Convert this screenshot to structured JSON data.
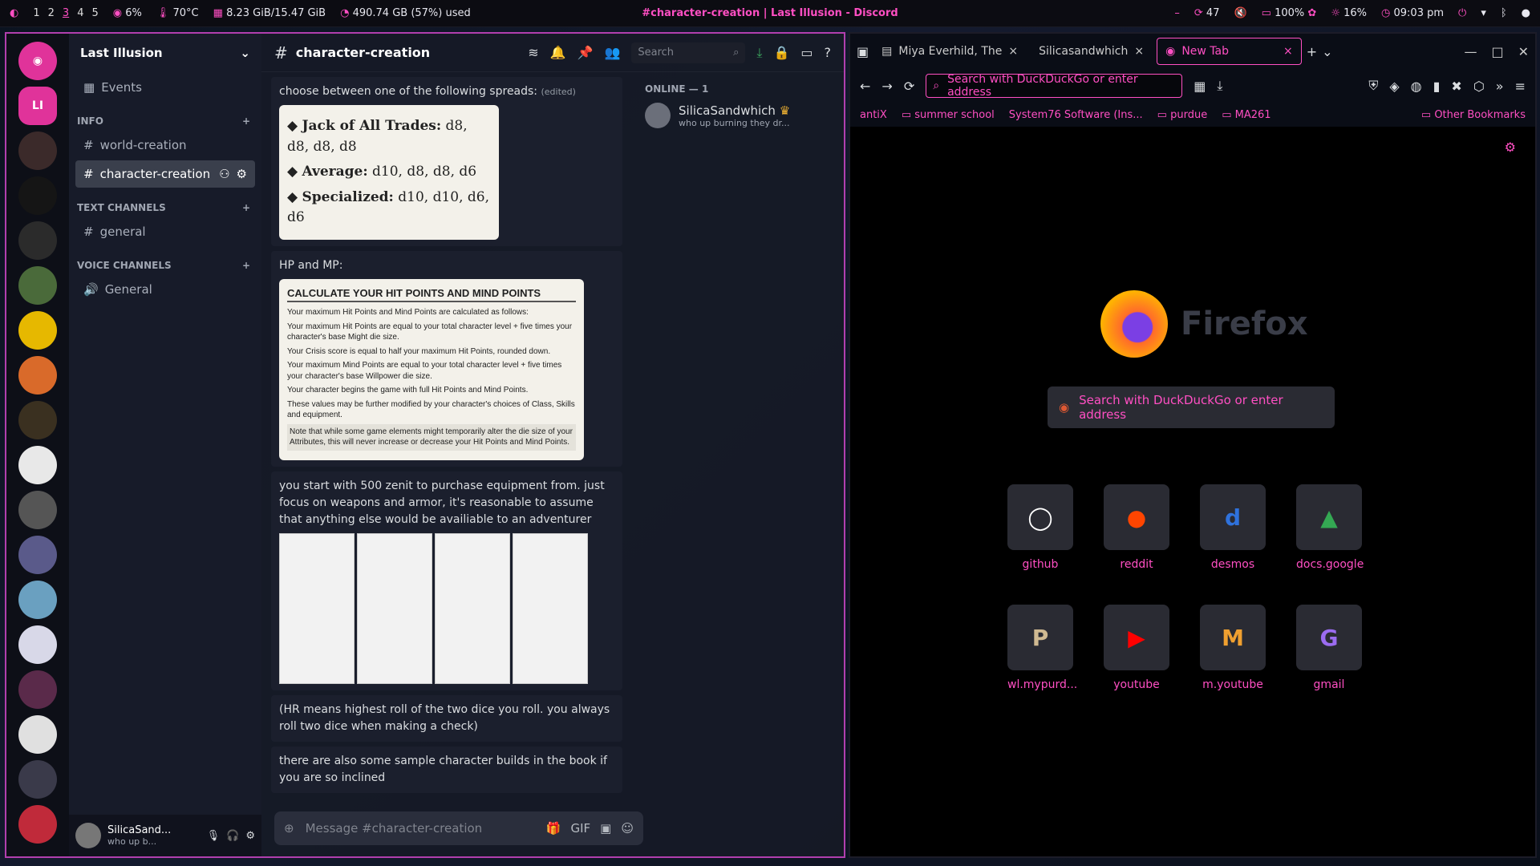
{
  "topbar": {
    "workspaces": [
      "1",
      "2",
      "3",
      "4",
      "5"
    ],
    "active_workspace": "3",
    "cpu": "6%",
    "temp": "70°C",
    "ram": "8.23 GiB/15.47 GiB",
    "disk": "490.74 GB (57%) used",
    "window_title": "#character-creation | Last Illusion - Discord",
    "updates": "47",
    "volume": "100%",
    "brightness": "16%",
    "clock": "09:03 pm"
  },
  "discord": {
    "guild_name": "Last Illusion",
    "events": "Events",
    "categories": {
      "info": "INFO",
      "text": "TEXT CHANNELS",
      "voice": "VOICE CHANNELS"
    },
    "channels": {
      "world": "world-creation",
      "character": "character-creation",
      "general": "general",
      "voice_general": "General"
    },
    "server_initials": "LI",
    "channel_title": "character-creation",
    "search_placeholder": "Search",
    "messages": {
      "spreads_intro": "choose between one of the following spreads:",
      "edited": "(edited)",
      "spreads": [
        {
          "name": "Jack of All Trades:",
          "dice": "d8, d8, d8, d8"
        },
        {
          "name": "Average:",
          "dice": "d10, d8, d8, d6"
        },
        {
          "name": "Specialized:",
          "dice": "d10, d10, d6, d6"
        }
      ],
      "hp_label": "HP and MP:",
      "hp_card": {
        "title": "CALCULATE YOUR HIT POINTS AND MIND POINTS",
        "intro": "Your maximum Hit Points and Mind Points are calculated as follows:",
        "b1": "Your maximum Hit Points are equal to your total character level + five times your character's base Might die size.",
        "b2": "Your Crisis score is equal to half your maximum Hit Points, rounded down.",
        "b3": "Your maximum Mind Points are equal to your total character level + five times your character's base Willpower die size.",
        "p1": "Your character begins the game with full Hit Points and Mind Points.",
        "p2": "These values may be further modified by your character's choices of Class, Skills and equipment.",
        "p3": "Note that while some game elements might temporarily alter the die size of your Attributes, this will never increase or decrease your Hit Points and Mind Points."
      },
      "zenit": "you start with 500 zenit to purchase equipment from. just focus on weapons and armor, it's reasonable to assume that anything else would be availiable to an adventurer",
      "hr_note": "(HR means highest roll of the two dice you roll. you always roll two dice when making a check)",
      "builds": "there are also some sample character builds in the book if you are so inclined"
    },
    "members": {
      "header": "ONLINE — 1",
      "name": "SilicaSandwhich",
      "status": "who up burning they dr..."
    },
    "user": {
      "name": "SilicaSand...",
      "status": "who up b..."
    },
    "composer_placeholder": "Message #character-creation"
  },
  "firefox": {
    "tabs": [
      "Miya Everhild, The",
      "Silicasandwhich",
      "New Tab"
    ],
    "url_placeholder": "Search with DuckDuckGo or enter address",
    "bookmarks": [
      "antiX",
      "summer school",
      "System76 Software (Ins...",
      "purdue",
      "MA261"
    ],
    "other_bookmarks": "Other Bookmarks",
    "brand": "Firefox",
    "search_placeholder": "Search with DuckDuckGo or enter address",
    "tiles": [
      "github",
      "reddit",
      "desmos",
      "docs.google",
      "wl.mypurd...",
      "youtube",
      "m.youtube",
      "gmail"
    ]
  }
}
